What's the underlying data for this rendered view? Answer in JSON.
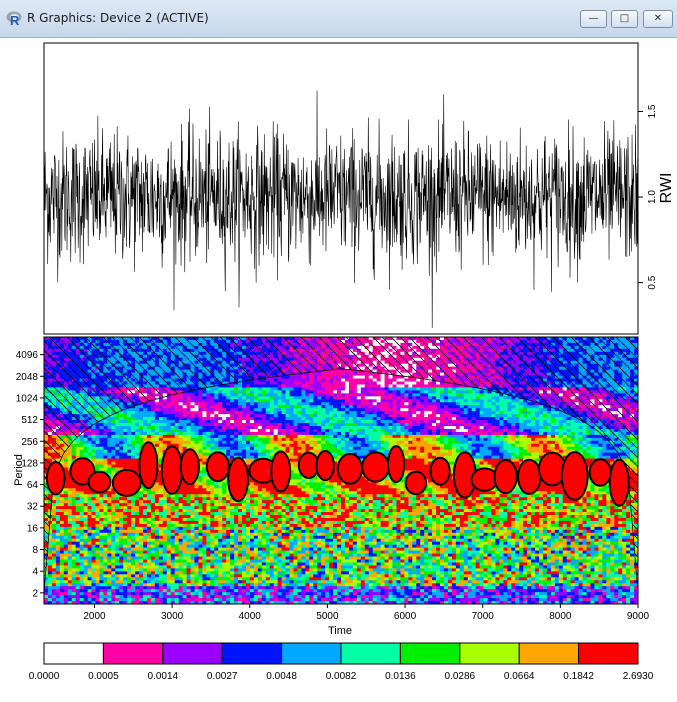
{
  "window": {
    "title": "R Graphics: Device 2 (ACTIVE)",
    "minimize_glyph": "—",
    "maximize_glyph": "□",
    "close_glyph": "✕",
    "icon": "r-logo-icon"
  },
  "chart_data": [
    {
      "type": "line",
      "ylabel": "RWI",
      "x_range": [
        1350,
        9000
      ],
      "ylim": [
        0.2,
        1.9
      ],
      "ytick_labels": [
        "0.5",
        "1.0",
        "1.5"
      ],
      "ytick_values": [
        0.5,
        1.0,
        1.5
      ],
      "y_axis_side": "right",
      "mean": 1.0,
      "typical_range": [
        0.6,
        1.4
      ],
      "color": "#000000"
    },
    {
      "type": "heatmap",
      "xlabel": "Time",
      "ylabel": "Period",
      "x_range": [
        1350,
        9000
      ],
      "xtick_values": [
        2000,
        3000,
        4000,
        5000,
        6000,
        7000,
        8000,
        9000
      ],
      "xtick_labels": [
        "2000",
        "3000",
        "4000",
        "5000",
        "6000",
        "7000",
        "8000",
        "9000"
      ],
      "y_scale": "log2",
      "ytick_values": [
        2,
        4,
        8,
        16,
        32,
        64,
        128,
        256,
        512,
        1024,
        2048,
        4096
      ],
      "ytick_labels": [
        "2",
        "4",
        "8",
        "16",
        "32",
        "64",
        "128",
        "256",
        "512",
        "1024",
        "2048",
        "4096"
      ],
      "legend": {
        "breaks": [
          "0.0000",
          "0.0005",
          "0.0014",
          "0.0027",
          "0.0048",
          "0.0082",
          "0.0136",
          "0.0286",
          "0.0664",
          "0.1842",
          "2.6930"
        ],
        "colors": [
          "#ffffff",
          "#ff00a6",
          "#9a00ff",
          "#0015ff",
          "#00a8ff",
          "#00ffa4",
          "#00ee00",
          "#a8ff00",
          "#ffa500",
          "#ff0000"
        ]
      },
      "cone_of_influence": "hatched",
      "significance_contours": "black"
    }
  ]
}
